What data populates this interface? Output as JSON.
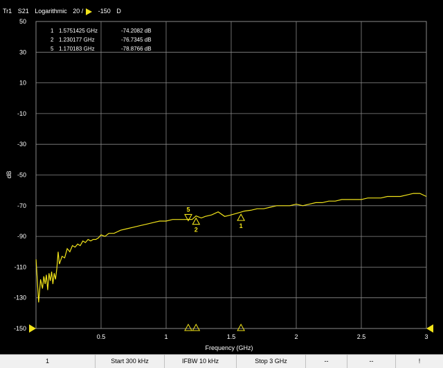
{
  "title_bar": {
    "trace": "Tr1",
    "param": "S21",
    "format": "Logarithmic",
    "scale": "20 /",
    "ref": "-150",
    "flag": "D"
  },
  "colors": {
    "trace": "#f2e41a",
    "grid": "#8a8a8a",
    "background": "#000000",
    "text": "#ffffff"
  },
  "marker_table": [
    {
      "id": "1",
      "freq": "1.5751425 GHz",
      "value": "-74.2082 dB"
    },
    {
      "id": "2",
      "freq": "1.230177 GHz",
      "value": "-76.7345 dB"
    },
    {
      "id": "5",
      "freq": "1.170183 GHz",
      "value": "-78.8766 dB"
    }
  ],
  "chart_data": {
    "type": "line",
    "xlabel": "Frequency (GHz)",
    "ylabel": "dB",
    "xlim": [
      0.0003,
      3
    ],
    "ylim": [
      -150,
      50
    ],
    "x_ticks": [
      "0.5",
      "1",
      "1.5",
      "2",
      "2.5",
      "3"
    ],
    "y_ticks": [
      "50",
      "30",
      "10",
      "-10",
      "-30",
      "-50",
      "-70",
      "-90",
      "-110",
      "-130",
      "-150"
    ],
    "grid": true,
    "series": [
      {
        "x": [
          0.0003,
          0.02,
          0.035,
          0.05,
          0.06,
          0.07,
          0.08,
          0.09,
          0.1,
          0.11,
          0.12,
          0.13,
          0.14,
          0.15,
          0.16,
          0.17,
          0.18,
          0.2,
          0.22,
          0.24,
          0.26,
          0.28,
          0.3,
          0.32,
          0.34,
          0.36,
          0.38,
          0.4,
          0.42,
          0.44,
          0.46,
          0.48,
          0.5,
          0.53,
          0.56,
          0.6,
          0.65,
          0.7,
          0.75,
          0.8,
          0.85,
          0.9,
          0.95,
          1,
          1.05,
          1.1,
          1.15,
          1.17,
          1.2,
          1.23,
          1.27,
          1.3,
          1.35,
          1.4,
          1.45,
          1.5,
          1.575,
          1.6,
          1.65,
          1.7,
          1.75,
          1.8,
          1.85,
          1.9,
          1.95,
          2,
          2.05,
          2.1,
          2.15,
          2.2,
          2.25,
          2.3,
          2.35,
          2.4,
          2.45,
          2.5,
          2.55,
          2.6,
          2.65,
          2.7,
          2.75,
          2.8,
          2.85,
          2.9,
          2.95,
          3
        ],
        "y": [
          -105,
          -133,
          -118,
          -124,
          -116,
          -121,
          -115,
          -125,
          -114,
          -119,
          -113,
          -121,
          -114,
          -118,
          -111,
          -100,
          -108,
          -103,
          -104,
          -98,
          -100,
          -96,
          -97,
          -95,
          -96,
          -93,
          -94,
          -92,
          -93,
          -92,
          -92,
          -91,
          -89,
          -90,
          -88,
          -88,
          -86,
          -85,
          -84,
          -83,
          -82,
          -81,
          -80,
          -80,
          -79,
          -79,
          -79,
          -78.9,
          -79,
          -76.7,
          -78,
          -77,
          -76,
          -74,
          -77,
          -76,
          -74.2,
          -73.5,
          -73,
          -72,
          -72,
          -71,
          -70,
          -70,
          -70,
          -69,
          -70,
          -69,
          -68,
          -68,
          -67,
          -67,
          -66,
          -66,
          -66,
          -66,
          -65,
          -65,
          -65,
          -64,
          -64,
          -64,
          -63,
          -62,
          -62,
          -64
        ]
      }
    ],
    "markers": [
      {
        "id": "1",
        "x": 1.5751425,
        "y": -74.2082,
        "direction": "up"
      },
      {
        "id": "2",
        "x": 1.230177,
        "y": -76.7345,
        "direction": "up"
      },
      {
        "id": "5",
        "x": 1.170183,
        "y": -78.8766,
        "direction": "down"
      }
    ]
  },
  "status_bar": {
    "channel": "1",
    "start": "Start 300 kHz",
    "ifbw": "IFBW 10 kHz",
    "stop": "Stop 3 GHz",
    "f1": "--",
    "f2": "--",
    "f3": "!"
  }
}
